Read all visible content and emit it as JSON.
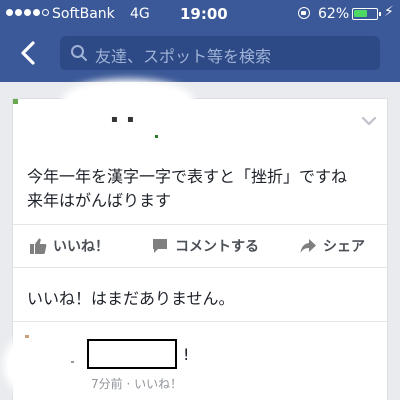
{
  "status_bar": {
    "signal_dots_filled": 4,
    "signal_dots_total": 5,
    "carrier": "SoftBank",
    "network": "4G",
    "time": "19:00",
    "battery_percent_label": "62%",
    "battery_level": 0.62,
    "battery_color": "#4cd964"
  },
  "nav_bar": {
    "background": "#3b5998",
    "search": {
      "placeholder": "友達、スポット等を検索"
    }
  },
  "post": {
    "text_lines": [
      "今年一年を漢字一字で表すと「挫折」ですね",
      "来年はがんばります"
    ],
    "actions": {
      "like": "いいね！",
      "comment": "コメントする",
      "share": "シェア"
    },
    "likes_summary": "いいね！はまだありません。",
    "comment": {
      "text": "!",
      "time": "7分前",
      "separator": "·",
      "like_link": "いいね！"
    }
  }
}
